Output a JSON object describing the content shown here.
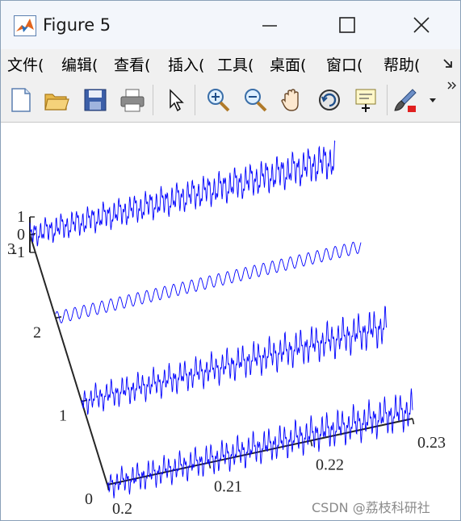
{
  "window": {
    "title": "Figure 5"
  },
  "menu": [
    "文件(",
    "编辑(",
    "查看(",
    "插入(",
    "工具(",
    "桌面(",
    "窗口(",
    "帮助("
  ],
  "toolbar_icons": [
    "new-file-icon",
    "open-folder-icon",
    "save-icon",
    "print-icon",
    "pointer-icon",
    "zoom-in-icon",
    "zoom-out-icon",
    "pan-hand-icon",
    "rotate-3d-icon",
    "data-cursor-icon",
    "brush-icon"
  ],
  "watermark": "CSDN @荔枝科研社",
  "colors": {
    "line": "#0000ff",
    "axis": "#262626"
  },
  "chart_data": {
    "type": "line",
    "view": "3d",
    "x_ticks": [
      "0.2",
      "0.21",
      "0.22",
      "0.23"
    ],
    "xlim": [
      0.2,
      0.23
    ],
    "y_ticks": [
      "0",
      "1",
      "2",
      "3"
    ],
    "ylim": [
      0,
      3
    ],
    "z_ticks": [
      "-1",
      "0",
      "1"
    ],
    "zlim": [
      -1,
      1
    ],
    "series": [
      {
        "y": 0,
        "xrange": [
          0.2,
          0.23
        ],
        "waveform": "irregular dense oscillation with rising trend",
        "amplitude": 1.0
      },
      {
        "y": 1,
        "xrange": [
          0.2,
          0.23
        ],
        "waveform": "irregular dense oscillation with rising trend",
        "amplitude": 1.0
      },
      {
        "y": 2,
        "xrange": [
          0.2,
          0.23
        ],
        "waveform": "regular sinusoid with rising trend",
        "amplitude": 0.35
      },
      {
        "y": 3,
        "xrange": [
          0.2,
          0.23
        ],
        "waveform": "irregular dense oscillation with rising trend",
        "amplitude": 1.0
      }
    ]
  }
}
